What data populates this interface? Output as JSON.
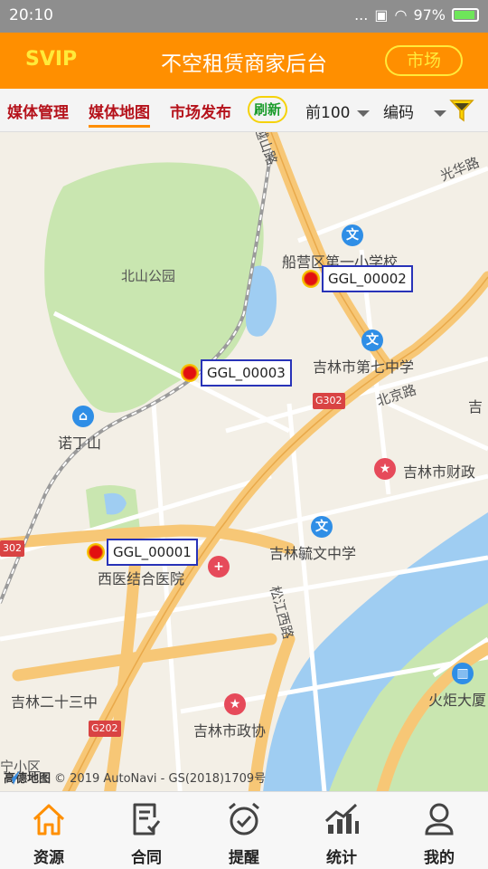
{
  "status_bar": {
    "time": "20:10",
    "signal": "...",
    "battery": "97%"
  },
  "header": {
    "svip": "SVIP",
    "title": "不空租赁商家后台",
    "market_button": "市场"
  },
  "tabs": {
    "media_manage": "媒体管理",
    "media_map": "媒体地图",
    "market_publish": "市场发布",
    "refresh": "刷新",
    "top_filter": "前100",
    "code_filter": "编码"
  },
  "map": {
    "labels": {
      "beishan_park": "北山公园",
      "nuodingshan": "诺丁山",
      "xiyi_hospital": "西医结合医院",
      "primary_school": "船营区第一小学校",
      "seventh_middle": "吉林市第七中学",
      "yuwen_middle": "吉林毓文中学",
      "finance": "吉林市财政",
      "political": "吉林市政协",
      "ershisan_middle": "吉林二十三中",
      "huoju": "火炬大厦",
      "beijing_road": "北京路",
      "guanghua_road": "光华路",
      "yueshan_road": "越山路",
      "songjiang_road": "松江西路",
      "jili_partial": "吉",
      "district_partial": "宁小区"
    },
    "road_badges": {
      "g302_a": "G302",
      "g302_b": "302",
      "g202": "G202"
    },
    "markers": [
      {
        "id": "GGL_00001"
      },
      {
        "id": "GGL_00002"
      },
      {
        "id": "GGL_00003"
      }
    ],
    "poi_icons": {
      "education": "文",
      "hospital": "+",
      "government": "★",
      "landmark": "▥",
      "place": "⌂"
    },
    "copyright": "© 2019 AutoNavi - GS(2018)1709号",
    "logo": "高德地图"
  },
  "bottom_nav": [
    {
      "label": "资源",
      "icon": "home-icon"
    },
    {
      "label": "合同",
      "icon": "contract-icon"
    },
    {
      "label": "提醒",
      "icon": "alarm-icon"
    },
    {
      "label": "统计",
      "icon": "stats-icon"
    },
    {
      "label": "我的",
      "icon": "user-icon"
    }
  ],
  "colors": {
    "header": "#ff8f00",
    "accent": "#ffea3a",
    "tab_text": "#b5121b",
    "active_nav": "#ff8f00"
  }
}
